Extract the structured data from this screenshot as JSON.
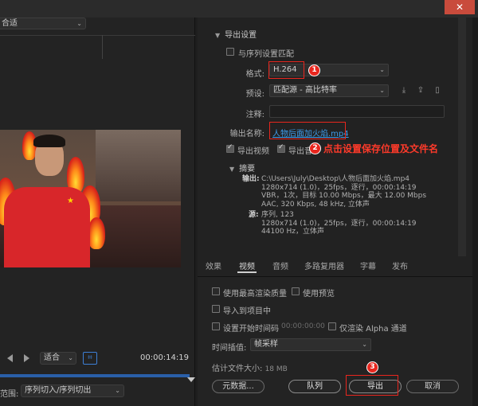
{
  "window": {
    "close_glyph": "✕"
  },
  "left_pane": {
    "fit_top": "合适",
    "fit_bottom": "适合",
    "timecode": "00:00:14:19",
    "range_label": "范围:",
    "range_value": "序列切入/序列切出"
  },
  "export_settings": {
    "section_title": "导出设置",
    "match_sequence": "与序列设置匹配",
    "format_label": "格式:",
    "format_value": "H.264",
    "preset_label": "预设:",
    "preset_value": "匹配源 - 高比特率",
    "comment_label": "注释:",
    "comment_value": "",
    "output_name_label": "输出名称:",
    "output_name_value": "人物后面加火焰.mp4",
    "export_video": "导出视频",
    "export_audio": "导出音",
    "summary_title": "摘要",
    "summary_output_label": "输出:",
    "summary_output_lines": [
      "C:\\Users\\July\\Desktop\\人物后面加火焰.mp4",
      "1280x714 (1.0)，25fps，逐行，00:00:14:19",
      "VBR，1次，目标 10.00 Mbps，最大 12.00 Mbps",
      "AAC, 320 Kbps, 48  kHz, 立体声"
    ],
    "summary_source_label": "源:",
    "summary_source_lines": [
      "序列, 123",
      "1280x714 (1.0)，25fps，逐行，00:00:14:19",
      "44100 Hz，立体声"
    ]
  },
  "annotations": {
    "marker_1": "1",
    "marker_2": "2",
    "marker_3": "3",
    "callout_2": "点击设置保存位置及文件名"
  },
  "tabs": [
    "效果",
    "视频",
    "音频",
    "多路复用器",
    "字幕",
    "发布"
  ],
  "active_tab": "视频",
  "bottom": {
    "use_max_render": "使用最高渲染质量",
    "use_preview": "使用预览",
    "import_to_project": "导入到项目中",
    "set_start_timecode": "设置开始时间码",
    "start_timecode_value": "00:00:00:00",
    "render_alpha_only": "仅渲染 Alpha 通道",
    "time_interp_label": "时间插值:",
    "time_interp_value": "帧采样",
    "est_size_label": "估计文件大小:",
    "est_size_value": "18 MB",
    "metadata_button": "元数据...",
    "queue_button": "队列",
    "export_button": "导出",
    "cancel_button": "取消"
  },
  "colors": {
    "accent_blue": "#3d9be9",
    "annotation_red": "#e8261e"
  }
}
